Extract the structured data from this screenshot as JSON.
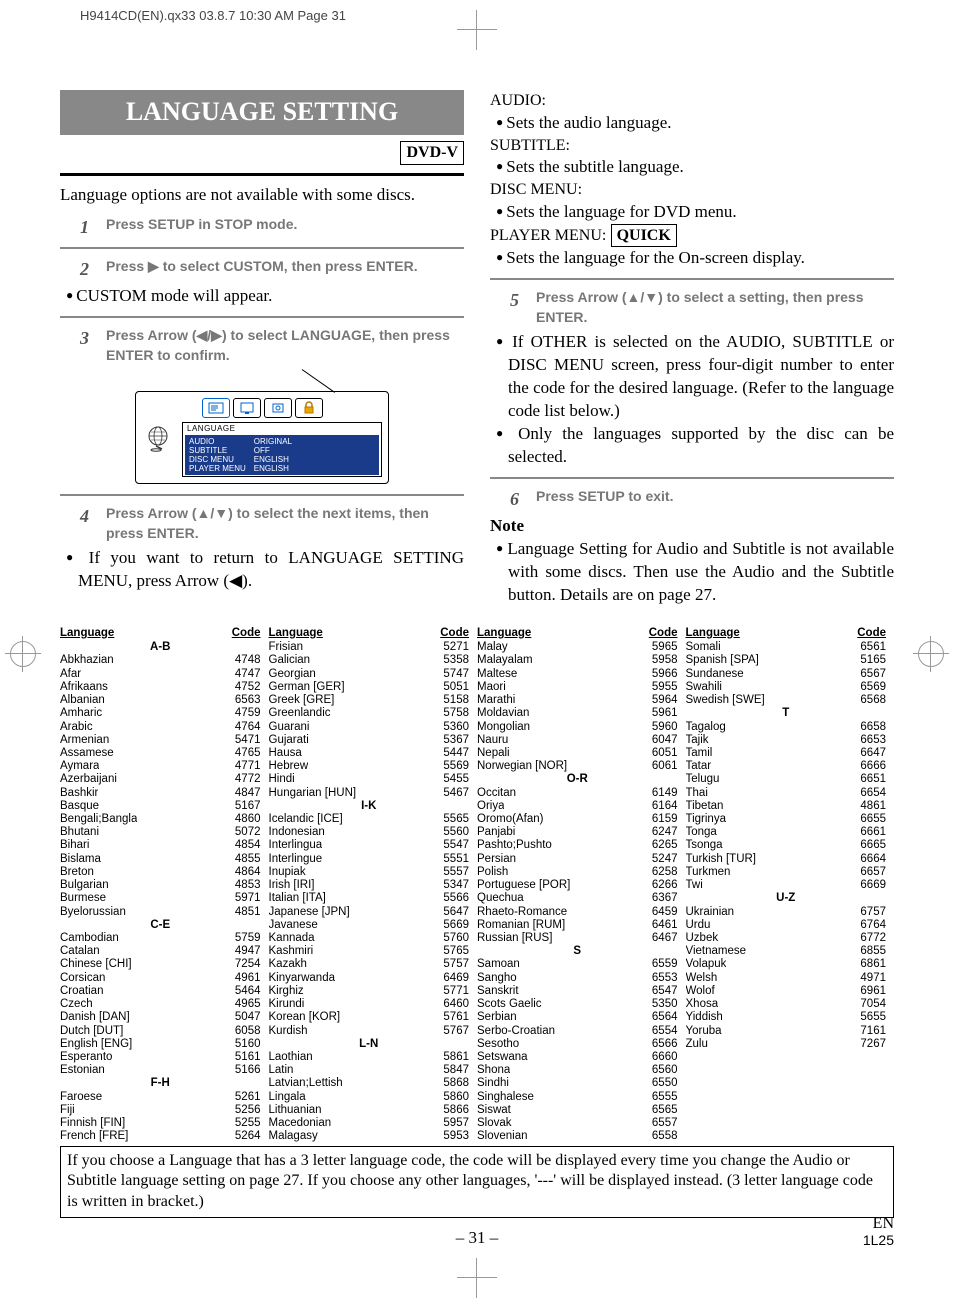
{
  "header_line": "H9414CD(EN).qx33  03.8.7 10:30 AM  Page 31",
  "title": "LANGUAGE SETTING",
  "dvd_tag": "DVD-V",
  "intro": "Language options are not available with some discs.",
  "step1": "Press SETUP in STOP mode.",
  "step2": "Press ▶ to select CUSTOM, then press ENTER.",
  "step2_note": "CUSTOM mode will appear.",
  "step3": "Press Arrow (◀/▶) to select LANGUAGE, then press ENTER to confirm.",
  "osd": {
    "panel_label": "LANGUAGE",
    "left": [
      "AUDIO",
      "SUBTITLE",
      "DISC MENU",
      "PLAYER MENU"
    ],
    "right": [
      "ORIGINAL",
      "OFF",
      "ENGLISH",
      "ENGLISH"
    ]
  },
  "step4": "Press Arrow (▲/▼) to select the next items, then press ENTER.",
  "step4_note": "If you want to return to LANGUAGE SETTING MENU, press Arrow (◀).",
  "rc": {
    "audio_h": "AUDIO:",
    "audio_t": "Sets the audio language.",
    "sub_h": "SUBTITLE:",
    "sub_t": "Sets the subtitle language.",
    "disc_h": "DISC MENU:",
    "disc_t": "Sets the language for DVD menu.",
    "player_h": "PLAYER MENU:",
    "quick": "QUICK",
    "player_t": "Sets the language for the On-screen display."
  },
  "step5": "Press Arrow (▲/▼) to select a setting, then press ENTER.",
  "step5_note1": "If OTHER is selected on the AUDIO, SUBTITLE or DISC MENU screen, press four-digit number to enter the code for the desired language. (Refer to the language code list below.)",
  "step5_note2": "Only the languages supported by the disc can be selected.",
  "step6": "Press SETUP to exit.",
  "note_head": "Note",
  "note_body": "Language Setting for Audio and Subtitle is not available with some discs. Then use the Audio and the Subtitle button. Details are on page 27.",
  "table_headers": {
    "lang": "Language",
    "code": "Code"
  },
  "sections": [
    "A-B",
    "C-E",
    "F-H",
    "I-K",
    "L-N",
    "O-R",
    "S",
    "T",
    "U-Z"
  ],
  "col1": [
    {
      "sec": "A-B"
    },
    {
      "l": "Abkhazian",
      "c": "4748"
    },
    {
      "l": "Afar",
      "c": "4747"
    },
    {
      "l": "Afrikaans",
      "c": "4752"
    },
    {
      "l": "Albanian",
      "c": "6563"
    },
    {
      "l": "Amharic",
      "c": "4759"
    },
    {
      "l": "Arabic",
      "c": "4764"
    },
    {
      "l": "Armenian",
      "c": "5471"
    },
    {
      "l": "Assamese",
      "c": "4765"
    },
    {
      "l": "Aymara",
      "c": "4771"
    },
    {
      "l": "Azerbaijani",
      "c": "4772"
    },
    {
      "l": "Bashkir",
      "c": "4847"
    },
    {
      "l": "Basque",
      "c": "5167"
    },
    {
      "l": "Bengali;Bangla",
      "c": "4860"
    },
    {
      "l": "Bhutani",
      "c": "5072"
    },
    {
      "l": "Bihari",
      "c": "4854"
    },
    {
      "l": "Bislama",
      "c": "4855"
    },
    {
      "l": "Breton",
      "c": "4864"
    },
    {
      "l": "Bulgarian",
      "c": "4853"
    },
    {
      "l": "Burmese",
      "c": "5971"
    },
    {
      "l": "Byelorussian",
      "c": "4851"
    },
    {
      "sec": "C-E"
    },
    {
      "l": "Cambodian",
      "c": "5759"
    },
    {
      "l": "Catalan",
      "c": "4947"
    },
    {
      "l": "Chinese [CHI]",
      "c": "7254"
    },
    {
      "l": "Corsican",
      "c": "4961"
    },
    {
      "l": "Croatian",
      "c": "5464"
    },
    {
      "l": "Czech",
      "c": "4965"
    },
    {
      "l": "Danish [DAN]",
      "c": "5047"
    },
    {
      "l": "Dutch [DUT]",
      "c": "6058"
    },
    {
      "l": "English [ENG]",
      "c": "5160"
    },
    {
      "l": "Esperanto",
      "c": "5161"
    },
    {
      "l": "Estonian",
      "c": "5166"
    },
    {
      "sec": "F-H"
    },
    {
      "l": "Faroese",
      "c": "5261"
    },
    {
      "l": "Fiji",
      "c": "5256"
    },
    {
      "l": "Finnish [FIN]",
      "c": "5255"
    },
    {
      "l": "French [FRE]",
      "c": "5264"
    }
  ],
  "col2": [
    {
      "l": "Frisian",
      "c": "5271"
    },
    {
      "l": "Galician",
      "c": "5358"
    },
    {
      "l": "Georgian",
      "c": "5747"
    },
    {
      "l": "German [GER]",
      "c": "5051"
    },
    {
      "l": "Greek [GRE]",
      "c": "5158"
    },
    {
      "l": "Greenlandic",
      "c": "5758"
    },
    {
      "l": "Guarani",
      "c": "5360"
    },
    {
      "l": "Gujarati",
      "c": "5367"
    },
    {
      "l": "Hausa",
      "c": "5447"
    },
    {
      "l": "Hebrew",
      "c": "5569"
    },
    {
      "l": "Hindi",
      "c": "5455"
    },
    {
      "l": "Hungarian [HUN]",
      "c": "5467"
    },
    {
      "sec": "I-K"
    },
    {
      "l": "Icelandic [ICE]",
      "c": "5565"
    },
    {
      "l": "Indonesian",
      "c": "5560"
    },
    {
      "l": "Interlingua",
      "c": "5547"
    },
    {
      "l": "Interlingue",
      "c": "5551"
    },
    {
      "l": "Inupiak",
      "c": "5557"
    },
    {
      "l": "Irish [IRI]",
      "c": "5347"
    },
    {
      "l": "Italian [ITA]",
      "c": "5566"
    },
    {
      "l": "Japanese [JPN]",
      "c": "5647"
    },
    {
      "l": "Javanese",
      "c": "5669"
    },
    {
      "l": "Kannada",
      "c": "5760"
    },
    {
      "l": "Kashmiri",
      "c": "5765"
    },
    {
      "l": "Kazakh",
      "c": "5757"
    },
    {
      "l": "Kinyarwanda",
      "c": "6469"
    },
    {
      "l": "Kirghiz",
      "c": "5771"
    },
    {
      "l": "Kirundi",
      "c": "6460"
    },
    {
      "l": "Korean [KOR]",
      "c": "5761"
    },
    {
      "l": "Kurdish",
      "c": "5767"
    },
    {
      "sec": "L-N"
    },
    {
      "l": "Laothian",
      "c": "5861"
    },
    {
      "l": "Latin",
      "c": "5847"
    },
    {
      "l": "Latvian;Lettish",
      "c": "5868"
    },
    {
      "l": "Lingala",
      "c": "5860"
    },
    {
      "l": "Lithuanian",
      "c": "5866"
    },
    {
      "l": "Macedonian",
      "c": "5957"
    },
    {
      "l": "Malagasy",
      "c": "5953"
    }
  ],
  "col3": [
    {
      "l": "Malay",
      "c": "5965"
    },
    {
      "l": "Malayalam",
      "c": "5958"
    },
    {
      "l": "Maltese",
      "c": "5966"
    },
    {
      "l": "Maori",
      "c": "5955"
    },
    {
      "l": "Marathi",
      "c": "5964"
    },
    {
      "l": "Moldavian",
      "c": "5961"
    },
    {
      "l": "Mongolian",
      "c": "5960"
    },
    {
      "l": "Nauru",
      "c": "6047"
    },
    {
      "l": "Nepali",
      "c": "6051"
    },
    {
      "l": "Norwegian [NOR]",
      "c": "6061"
    },
    {
      "sec": "O-R"
    },
    {
      "l": "Occitan",
      "c": "6149"
    },
    {
      "l": "Oriya",
      "c": "6164"
    },
    {
      "l": "Oromo(Afan)",
      "c": "6159"
    },
    {
      "l": "Panjabi",
      "c": "6247"
    },
    {
      "l": "Pashto;Pushto",
      "c": "6265"
    },
    {
      "l": "Persian",
      "c": "5247"
    },
    {
      "l": "Polish",
      "c": "6258"
    },
    {
      "l": "Portuguese [POR]",
      "c": "6266"
    },
    {
      "l": "Quechua",
      "c": "6367"
    },
    {
      "l": "Rhaeto-Romance",
      "c": "6459"
    },
    {
      "l": "Romanian [RUM]",
      "c": "6461"
    },
    {
      "l": "Russian [RUS]",
      "c": "6467"
    },
    {
      "sec": "S"
    },
    {
      "l": "Samoan",
      "c": "6559"
    },
    {
      "l": "Sangho",
      "c": "6553"
    },
    {
      "l": "Sanskrit",
      "c": "6547"
    },
    {
      "l": "Scots Gaelic",
      "c": "5350"
    },
    {
      "l": "Serbian",
      "c": "6564"
    },
    {
      "l": "Serbo-Croatian",
      "c": "6554"
    },
    {
      "l": "Sesotho",
      "c": "6566"
    },
    {
      "l": "Setswana",
      "c": "6660"
    },
    {
      "l": "Shona",
      "c": "6560"
    },
    {
      "l": "Sindhi",
      "c": "6550"
    },
    {
      "l": "Singhalese",
      "c": "6555"
    },
    {
      "l": "Siswat",
      "c": "6565"
    },
    {
      "l": "Slovak",
      "c": "6557"
    },
    {
      "l": "Slovenian",
      "c": "6558"
    }
  ],
  "col4": [
    {
      "l": "Somali",
      "c": "6561"
    },
    {
      "l": "Spanish [SPA]",
      "c": "5165"
    },
    {
      "l": "Sundanese",
      "c": "6567"
    },
    {
      "l": "Swahili",
      "c": "6569"
    },
    {
      "l": "Swedish [SWE]",
      "c": "6568"
    },
    {
      "sec": "T"
    },
    {
      "l": "Tagalog",
      "c": "6658"
    },
    {
      "l": "Tajik",
      "c": "6653"
    },
    {
      "l": "Tamil",
      "c": "6647"
    },
    {
      "l": "Tatar",
      "c": "6666"
    },
    {
      "l": "Telugu",
      "c": "6651"
    },
    {
      "l": "Thai",
      "c": "6654"
    },
    {
      "l": "Tibetan",
      "c": "4861"
    },
    {
      "l": "Tigrinya",
      "c": "6655"
    },
    {
      "l": "Tonga",
      "c": "6661"
    },
    {
      "l": "Tsonga",
      "c": "6665"
    },
    {
      "l": "Turkish [TUR]",
      "c": "6664"
    },
    {
      "l": "Turkmen",
      "c": "6657"
    },
    {
      "l": "Twi",
      "c": "6669"
    },
    {
      "sec": "U-Z"
    },
    {
      "l": "Ukrainian",
      "c": "6757"
    },
    {
      "l": "Urdu",
      "c": "6764"
    },
    {
      "l": "Uzbek",
      "c": "6772"
    },
    {
      "l": "Vietnamese",
      "c": "6855"
    },
    {
      "l": "Volapuk",
      "c": "6861"
    },
    {
      "l": "Welsh",
      "c": "4971"
    },
    {
      "l": "Wolof",
      "c": "6961"
    },
    {
      "l": "Xhosa",
      "c": "7054"
    },
    {
      "l": "Yiddish",
      "c": "5655"
    },
    {
      "l": "Yoruba",
      "c": "7161"
    },
    {
      "l": "Zulu",
      "c": "7267"
    }
  ],
  "footnote": "If you choose a Language that has a 3 letter language code, the code will be displayed every time you change the Audio or Subtitle language setting on page 27. If you choose any other languages, '---' will be displayed instead. (3 letter language code is written in bracket.)",
  "page_num": "– 31 –",
  "corner_en": "EN",
  "corner_code": "1L25"
}
